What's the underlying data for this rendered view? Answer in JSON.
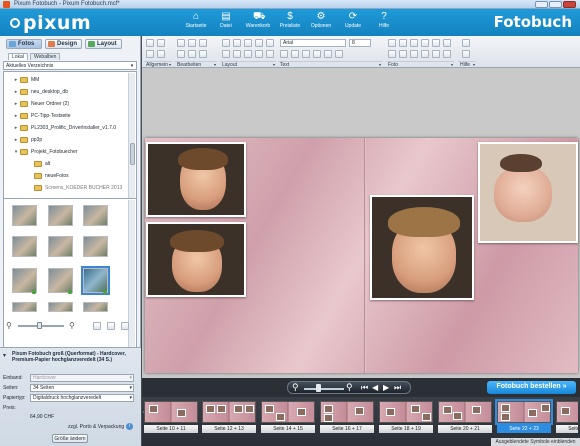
{
  "window": {
    "title": "Pixum Fotobuch - Pixum Fotobuch.mcf*"
  },
  "header": {
    "logo": "pixum",
    "brand": "Fotobuch",
    "menu": [
      {
        "label": "Startseite",
        "icon": "home-icon"
      },
      {
        "label": "Datei",
        "icon": "folder-icon"
      },
      {
        "label": "Warenkorb",
        "icon": "cart-icon"
      },
      {
        "label": "Preisliste",
        "icon": "price-icon"
      },
      {
        "label": "Optionen",
        "icon": "gear-icon"
      },
      {
        "label": "Update",
        "icon": "update-icon"
      },
      {
        "label": "Hilfe",
        "icon": "help-icon"
      }
    ]
  },
  "left": {
    "tabs": [
      "Fotos",
      "Design",
      "Layout"
    ],
    "subtabs": [
      "Lokal",
      "Webalben"
    ],
    "directory": "Aktuelles Verzeichnis",
    "tree": [
      "MM",
      "neu_desktop_db",
      "Neuer Ordner (2)",
      "PC-Tipp-Testseite",
      "PL2303_Prolific_DriverInstaller_v1.7.0",
      "pp3p",
      "Projekt_Fotobuecher",
      "alt",
      "neueFotos",
      "Screens_KOEDER BUCHER 2013"
    ],
    "product": {
      "title": "Pixum Fotobuch groß (Querformat) - Hardcover, Premium-Papier hochglanzveredelt (34 S.)",
      "fields": [
        {
          "label": "Einband:",
          "value": "Hardcover",
          "disabled": true
        },
        {
          "label": "Seiten:",
          "value": "34 Seiten",
          "disabled": false
        },
        {
          "label": "Papiertyp:",
          "value": "Digitaldruck hochglanzveredelt",
          "disabled": false
        }
      ],
      "price_label": "Preis:",
      "price": "64,90 CHF",
      "shipping": "zzgl. Porto & Verpackung",
      "size_button": "Größe ändern"
    }
  },
  "toolbar": {
    "groups": [
      "Allgemein",
      "Bearbeiten",
      "Layout",
      "Text",
      "Foto",
      "Hilfe"
    ],
    "font": "Arial",
    "font_size": "8"
  },
  "canvas": {
    "zoom_label": "Zoom"
  },
  "order_button": "Fotobuch bestellen »",
  "filmstrip": [
    "Seite 10 + 11",
    "Seite 12 + 13",
    "Seite 14 + 15",
    "Seite 16 + 17",
    "Seite 18 + 19",
    "Seite 20 + 21",
    "Seite 22 + 23",
    "Seite 24 + 25"
  ],
  "filmstrip_current": 6,
  "hidden_symbols": "Ausgeblendete Symbole einblenden"
}
